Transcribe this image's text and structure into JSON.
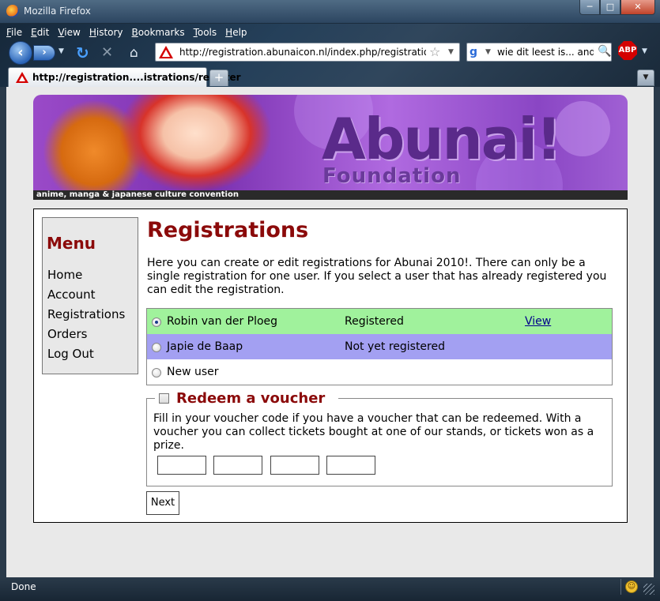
{
  "window": {
    "title": "Mozilla Firefox"
  },
  "menubar": [
    "File",
    "Edit",
    "View",
    "History",
    "Bookmarks",
    "Tools",
    "Help"
  ],
  "navbar": {
    "url": "http://registration.abunaicon.nl/index.php/registrations/register",
    "search_text": "wie dit leest is... anders",
    "abp_label": "ABP"
  },
  "tab": {
    "label": "http://registration....istrations/register"
  },
  "banner": {
    "logo": "Abunai!",
    "logo_sub": "Foundation",
    "tagline": "anime, manga & japanese culture convention"
  },
  "menu": {
    "title": "Menu",
    "items": [
      "Home",
      "Account",
      "Registrations",
      "Orders",
      "Log Out"
    ]
  },
  "page": {
    "title": "Registrations",
    "intro": "Here you can create or edit registrations for Abunai 2010!. There can only be a single registration for one user. If you select a user that has already registered you can edit the registration."
  },
  "registrations": [
    {
      "name": "Robin van der Ploeg",
      "status": "Registered",
      "action": "View",
      "selected": true,
      "color": "#a0f29c"
    },
    {
      "name": "Japie de Baap",
      "status": "Not yet registered",
      "action": "",
      "selected": false,
      "color": "#a3a0f2"
    },
    {
      "name": "New user",
      "status": "",
      "action": "",
      "selected": false,
      "color": "#ffffff"
    }
  ],
  "voucher": {
    "legend": "Redeem a voucher",
    "text": "Fill in your voucher code if you have a voucher that can be redeemed. With a voucher you can collect tickets bought at one of our stands, or tickets won as a prize.",
    "code_values": [
      "",
      "",
      "",
      ""
    ]
  },
  "next_label": "Next",
  "status": {
    "text": "Done"
  },
  "colors": {
    "accent": "#8b0a0a",
    "registered_row": "#a0f29c",
    "unregistered_row": "#a3a0f2"
  }
}
